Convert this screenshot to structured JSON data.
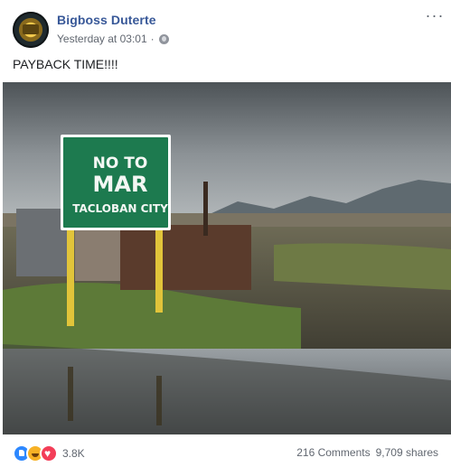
{
  "post": {
    "author": "Bigboss Duterte",
    "timestamp": "Yesterday at 03:01",
    "separator": "·",
    "privacy_icon": "globe-icon",
    "more_label": "···",
    "text": "PAYBACK TIME!!!!"
  },
  "photo": {
    "sign_line1": "NO TO",
    "sign_line2": "MAR",
    "sign_line3": "TACLOBAN CITY",
    "sign_color": "#1d7a4f"
  },
  "footer": {
    "reaction_icons": [
      "like-icon",
      "haha-icon",
      "love-icon"
    ],
    "reaction_count": "3.8K",
    "comments": "216 Comments",
    "shares": "9,709 shares"
  },
  "colors": {
    "author_link": "#385898",
    "meta_text": "#616770"
  }
}
